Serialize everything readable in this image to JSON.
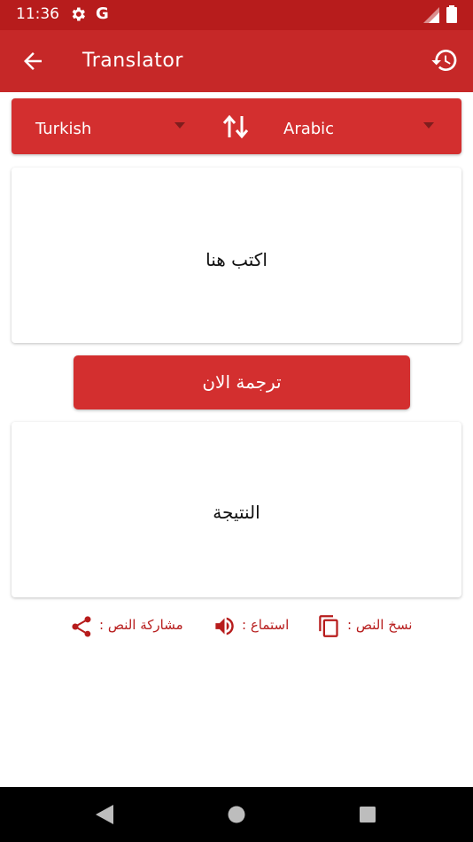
{
  "status_bar": {
    "time": "11:36",
    "g_label": "G"
  },
  "app_bar": {
    "title": "Translator"
  },
  "languages": {
    "source": "Turkish",
    "target": "Arabic"
  },
  "input": {
    "placeholder": "اكتب هنا"
  },
  "translate_button": {
    "label": "ترجمة الان"
  },
  "result": {
    "placeholder": "النتيجة"
  },
  "actions": {
    "share_label": "مشاركة النص :",
    "listen_label": "استماع :",
    "copy_label": "نسخ النص :"
  },
  "colors": {
    "status_bar": "#b71c1c",
    "app_bar": "#c62828",
    "accent": "#d32f2f",
    "action_text": "#b71c1c"
  },
  "icons": [
    "gear-icon",
    "signal-icon",
    "battery-icon",
    "back-arrow-icon",
    "history-icon",
    "dropdown-icon",
    "swap-icon",
    "share-icon",
    "speaker-icon",
    "copy-icon",
    "nav-back-icon",
    "nav-home-icon",
    "nav-recents-icon"
  ]
}
